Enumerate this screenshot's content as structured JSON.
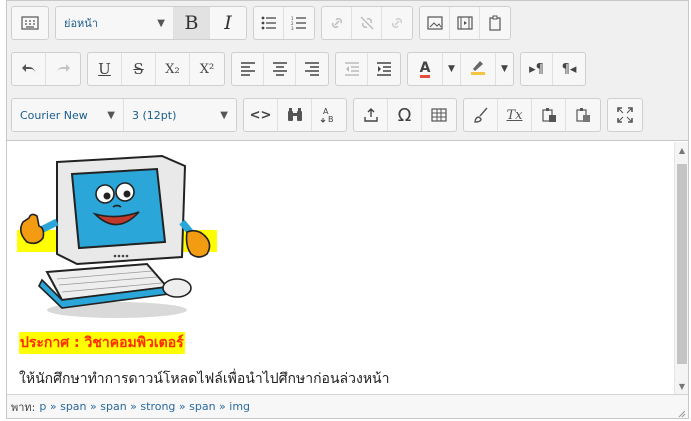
{
  "toolbar": {
    "row1": {
      "paragraph_format": "ย่อหน้า",
      "bold_label": "B",
      "italic_label": "I"
    },
    "row2": {
      "underline_label": "U",
      "strike_label": "S",
      "subscript_label": "X₂",
      "superscript_label": "X²",
      "text_color_label": "A",
      "ltr_label": "▸¶",
      "rtl_label": "¶◂"
    },
    "row3": {
      "font_family": "Courier New",
      "font_size": "3 (12pt)",
      "code_label": "<>",
      "omega_label": "Ω",
      "clear_format_label": "Tx"
    }
  },
  "content": {
    "announcement": "ประกาศ  :  วิชาคอมพิวเตอร์",
    "body_text": "ให้นักศึกษาทำการดาวน์โหลดไฟล์เพื่อนำไปศึกษาก่อนล่วงหน้า"
  },
  "statusbar": {
    "path_label": "พาท:",
    "path": "p » span » span » strong » span » img"
  },
  "colors": {
    "announcement_text": "#ff2b00",
    "announcement_highlight": "#ffff00",
    "status_path": "#2a6aa0",
    "notification_dot": "#e8465a"
  }
}
